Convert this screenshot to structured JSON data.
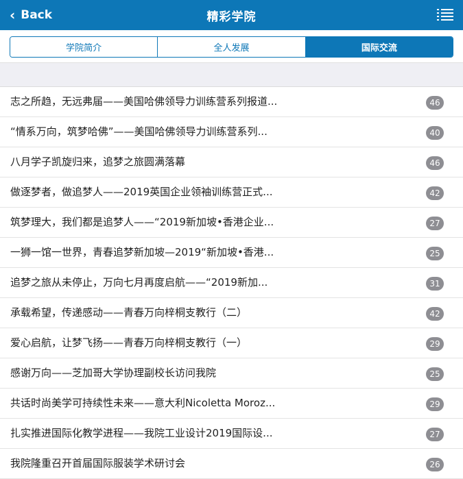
{
  "header": {
    "back_label": "Back",
    "title": "精彩学院",
    "menu_icon": "list-menu-icon"
  },
  "tabs": [
    {
      "label": "学院简介",
      "active": false
    },
    {
      "label": "全人发展",
      "active": false
    },
    {
      "label": "国际交流",
      "active": true
    }
  ],
  "colors": {
    "primary": "#0d77b7",
    "badge": "#8e8e93",
    "band": "#efeff4"
  },
  "articles": [
    {
      "title": "志之所趋，无远弗届——美国哈佛领导力训练营系列报道...",
      "count": "46"
    },
    {
      "title": "“情系万向，筑梦哈佛”——美国哈佛领导力训练营系列...",
      "count": "40"
    },
    {
      "title": "八月学子凯旋归来，追梦之旅圆满落幕",
      "count": "46"
    },
    {
      "title": "做逐梦者，做追梦人——2019英国企业领袖训练营正式...",
      "count": "42"
    },
    {
      "title": "筑梦理大，我们都是追梦人——“2019新加坡•香港企业...",
      "count": "27"
    },
    {
      "title": "一狮一馆一世界，青春追梦新加坡—2019“新加坡•香港...",
      "count": "25"
    },
    {
      "title": "追梦之旅从未停止，万向七月再度启航——“2019新加...",
      "count": "31"
    },
    {
      "title": "承载希望，传递感动——青春万向梓桐支教行（二）",
      "count": "42"
    },
    {
      "title": "爱心启航，让梦飞扬——青春万向梓桐支教行（一）",
      "count": "29"
    },
    {
      "title": "感谢万向——芝加哥大学协理副校长访问我院",
      "count": "25"
    },
    {
      "title": "共话时尚美学可持续性未来——意大利Nicoletta Moroz...",
      "count": "29"
    },
    {
      "title": "扎实推进国际化教学进程——我院工业设计2019国际设...",
      "count": "27"
    },
    {
      "title": "我院隆重召开首届国际服装学术研讨会",
      "count": "26"
    }
  ]
}
